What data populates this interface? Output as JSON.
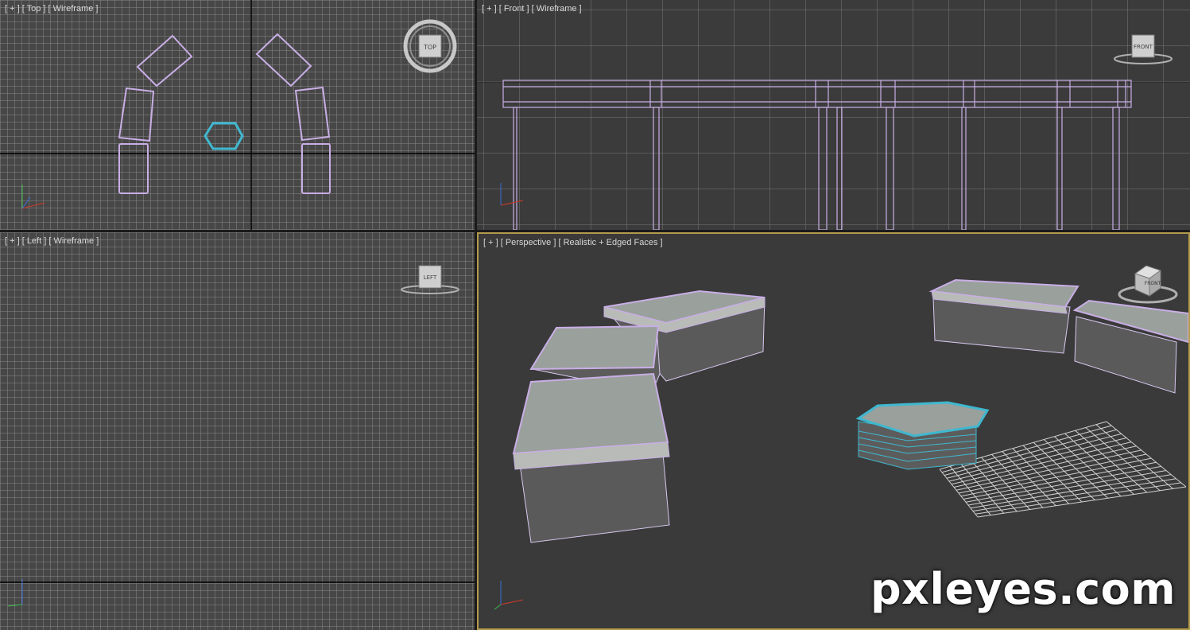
{
  "viewports": {
    "top": {
      "label": "[ + ] [ Top ] [ Wireframe ]",
      "navcube": "TOP"
    },
    "front": {
      "label": "[ + ] [ Front ] [ Wireframe ]",
      "navcube": "FRONT"
    },
    "left": {
      "label": "[ + ] [ Left ] [ Wireframe ]",
      "navcube": "LEFT"
    },
    "perspective": {
      "label": "[ + ] [ Perspective ] [ Realistic + Edged Faces ]",
      "navcube": "FRONT"
    }
  },
  "watermark": "pxleyes.com",
  "colors": {
    "wire_selected": "#3fb8d0",
    "wire_object": "#c9aee6",
    "active_border": "#b39b4a"
  }
}
